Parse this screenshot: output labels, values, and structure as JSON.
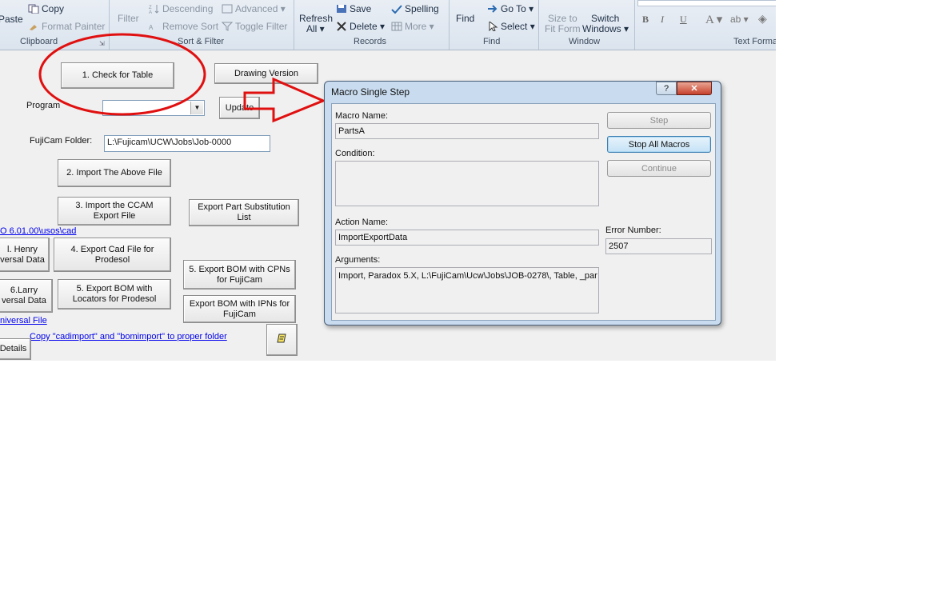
{
  "ribbon": {
    "paste": "Paste",
    "copy": "Copy",
    "format_painter": "Format Painter",
    "clipboard_group": "Clipboard",
    "filter": "Filter",
    "descending": "Descending",
    "remove_sort": "Remove Sort",
    "advanced": "Advanced",
    "toggle_filter": "Toggle Filter",
    "sort_filter_group": "Sort & Filter",
    "refresh": "Refresh",
    "refresh_all": "All",
    "save": "Save",
    "delete": "Delete",
    "spelling": "Spelling",
    "more": "More",
    "records_group": "Records",
    "find": "Find",
    "go_to": "Go To",
    "select": "Select",
    "find_group": "Find",
    "size_to": "Size to",
    "fit_form": "Fit Form",
    "switch": "Switch",
    "windows": "Windows",
    "window_group": "Window",
    "bold": "B",
    "italic": "I",
    "underline": "U",
    "text_format_group": "Text Forma"
  },
  "form": {
    "check_table": "1. Check for Table",
    "drawing_version": "Drawing Version",
    "program_label": "Program",
    "update": "Update",
    "fujicam_folder_label": "FujiCam Folder:",
    "fujicam_folder_value": "L:\\Fujicam\\UCW\\Jobs\\Job-0000",
    "import_above": "2. Import The Above File",
    "import_ccam": "3.  Import the CCAM Export File",
    "export_part_sub": "Export Part Substitution List",
    "path_link": "O 6.01.00\\usos\\cad",
    "henry": "l. Henry\nversal Data",
    "export_cad": "4. Export Cad File for Prodesol",
    "export_bom_cpn": "5. Export BOM with CPNs for FujiCam",
    "larry": "6.Larry\nversal Data",
    "export_bom_loc": "5. Export BOM with Locators for Prodesol",
    "export_bom_ipn": "Export BOM with IPNs for FujiCam",
    "universal_link": "niversal File",
    "copy_link": "Copy \"cadimport\" and \"bomimport\" to proper folder",
    "details": "Details"
  },
  "dialog": {
    "title": "Macro Single Step",
    "help": "?",
    "close": "✕",
    "macro_name_label": "Macro Name:",
    "macro_name_value": "PartsA",
    "condition_label": "Condition:",
    "condition_value": "",
    "action_name_label": "Action Name:",
    "action_name_value": "ImportExportData",
    "arguments_label": "Arguments:",
    "arguments_value": "Import, Paradox 5.X, L:\\FujiCam\\Ucw\\Jobs\\JOB-0278\\, Table, _par",
    "error_number_label": "Error Number:",
    "error_number_value": "2507",
    "step": "Step",
    "stop_all": "Stop All Macros",
    "continue": "Continue"
  },
  "colors": {
    "annotation_red": "#e01010",
    "link_blue": "#0000ee",
    "ribbon_bg": "#dfe7f0",
    "form_bg": "#f0f0f0"
  }
}
